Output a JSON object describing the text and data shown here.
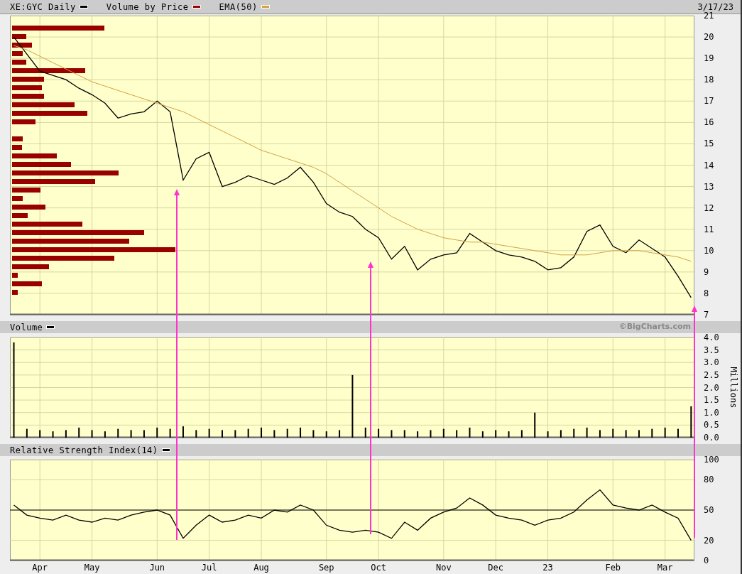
{
  "header": {
    "volume_by_price": {
      "label": "Volume by Price",
      "color": "#990000"
    },
    "date": "3/17/23"
  },
  "price_panel": {
    "chart_data": {
      "type": "line",
      "grid": true,
      "ylim": [
        7,
        21
      ],
      "categories": [
        null,
        null,
        null,
        null,
        null,
        null,
        null,
        null,
        null,
        null,
        null,
        null,
        null,
        null,
        null,
        null,
        null,
        null,
        null,
        null,
        null,
        null,
        null,
        null,
        null,
        null,
        null,
        null,
        null,
        null,
        null,
        null,
        null,
        null,
        null,
        null,
        null,
        null,
        null,
        null,
        null,
        null,
        null,
        null,
        null,
        null,
        null,
        null,
        null,
        null,
        null,
        null,
        null
      ],
      "yticks": [
        {
          "value": 7,
          "label": "7"
        },
        {
          "value": 8,
          "label": "8"
        },
        {
          "value": 9,
          "label": "9"
        },
        {
          "value": 10,
          "label": "10"
        },
        {
          "value": 11,
          "label": "11"
        },
        {
          "value": 12,
          "label": "12"
        },
        {
          "value": 13,
          "label": "13"
        },
        {
          "value": 14,
          "label": "14"
        },
        {
          "value": 15,
          "label": "15"
        },
        {
          "value": 16,
          "label": "16"
        },
        {
          "value": 17,
          "label": "17"
        },
        {
          "value": 18,
          "label": "18"
        },
        {
          "value": 19,
          "label": "19"
        },
        {
          "value": 20,
          "label": "20"
        },
        {
          "value": 21,
          "label": "21"
        }
      ],
      "series": [
        {
          "name": "XE:GYC Daily",
          "color": "#000000",
          "values": [
            20.0,
            19.2,
            18.4,
            18.2,
            18.0,
            17.6,
            17.3,
            16.9,
            16.2,
            16.4,
            16.5,
            17.0,
            16.5,
            13.3,
            14.3,
            14.6,
            13.0,
            13.2,
            13.5,
            13.3,
            13.1,
            13.4,
            13.9,
            13.2,
            12.2,
            11.8,
            11.6,
            11.0,
            10.6,
            9.6,
            10.2,
            9.1,
            9.6,
            9.8,
            9.9,
            10.8,
            10.4,
            10.0,
            9.8,
            9.7,
            9.5,
            9.1,
            9.2,
            9.7,
            10.9,
            11.2,
            10.2,
            9.9,
            10.5,
            10.1,
            9.7,
            8.8,
            7.8
          ]
        },
        {
          "name": "EMA(50)",
          "color": "#d4a040",
          "values": [
            19.6,
            19.4,
            19.1,
            18.8,
            18.5,
            18.2,
            17.9,
            17.7,
            17.5,
            17.3,
            17.1,
            16.9,
            16.7,
            16.5,
            16.2,
            15.9,
            15.6,
            15.3,
            15.0,
            14.7,
            14.5,
            14.3,
            14.1,
            13.9,
            13.6,
            13.2,
            12.8,
            12.4,
            12.0,
            11.6,
            11.3,
            11.0,
            10.8,
            10.6,
            10.5,
            10.4,
            10.4,
            10.3,
            10.2,
            10.1,
            10.0,
            9.9,
            9.8,
            9.8,
            9.8,
            9.9,
            10.0,
            10.0,
            10.0,
            9.9,
            9.8,
            9.7,
            9.5
          ]
        }
      ]
    }
  },
  "volume_panel": {
    "credit": "©BigCharts.com",
    "chart_data": {
      "type": "bar",
      "grid": true,
      "ylabel": "Millions",
      "ylim": [
        0,
        4
      ],
      "categories": [
        null,
        null,
        null,
        null,
        null,
        null,
        null,
        null,
        null,
        null,
        null,
        null,
        null,
        null,
        null,
        null,
        null,
        null,
        null,
        null,
        null,
        null,
        null,
        null,
        null,
        null,
        null,
        null,
        null,
        null,
        null,
        null,
        null,
        null,
        null,
        null,
        null,
        null,
        null,
        null,
        null,
        null,
        null,
        null,
        null,
        null,
        null,
        null,
        null,
        null,
        null,
        null,
        null
      ],
      "yticks": [
        {
          "value": 0,
          "label": "0.0"
        },
        {
          "value": 0.5,
          "label": "0.5"
        },
        {
          "value": 1,
          "label": "1.0"
        },
        {
          "value": 1.5,
          "label": "1.5"
        },
        {
          "value": 2,
          "label": "2.0"
        },
        {
          "value": 2.5,
          "label": "2.5"
        },
        {
          "value": 3,
          "label": "3.0"
        },
        {
          "value": 3.5,
          "label": "3.5"
        },
        {
          "value": 4,
          "label": "4.0"
        }
      ],
      "series": [
        {
          "name": "Volume",
          "color": "#000000",
          "values": [
            3.8,
            0.35,
            0.3,
            0.25,
            0.3,
            0.4,
            0.3,
            0.25,
            0.35,
            0.3,
            0.3,
            0.4,
            0.35,
            0.45,
            0.3,
            0.35,
            0.3,
            0.3,
            0.35,
            0.4,
            0.3,
            0.35,
            0.4,
            0.3,
            0.25,
            0.3,
            2.5,
            0.4,
            0.35,
            0.3,
            0.3,
            0.25,
            0.3,
            0.35,
            0.3,
            0.4,
            0.25,
            0.3,
            0.25,
            0.3,
            1.0,
            0.25,
            0.3,
            0.35,
            0.4,
            0.3,
            0.35,
            0.3,
            0.3,
            0.35,
            0.4,
            0.35,
            1.25
          ]
        }
      ]
    }
  },
  "rsi_panel": {
    "chart_data": {
      "type": "line",
      "grid": true,
      "ylim": [
        0,
        100
      ],
      "categories": [
        null,
        null,
        "Apr",
        null,
        null,
        null,
        "May",
        null,
        null,
        null,
        null,
        "Jun",
        null,
        null,
        null,
        "Jul",
        null,
        null,
        null,
        "Aug",
        null,
        null,
        null,
        null,
        "Sep",
        null,
        null,
        null,
        "Oct",
        null,
        null,
        null,
        null,
        "Nov",
        null,
        null,
        null,
        "Dec",
        null,
        null,
        null,
        "23",
        null,
        null,
        null,
        null,
        "Feb",
        null,
        null,
        null,
        "Mar",
        null,
        null
      ],
      "yticks": [
        {
          "value": 0,
          "label": "0"
        },
        {
          "value": 20,
          "label": "20"
        },
        {
          "value": 50,
          "label": "50"
        },
        {
          "value": 80,
          "label": "80"
        },
        {
          "value": 100,
          "label": "100"
        }
      ],
      "ref_lines": [
        {
          "axis": "y",
          "value": 50
        }
      ],
      "series": [
        {
          "name": "Relative Strength Index(14)",
          "color": "#000000",
          "values": [
            55,
            45,
            42,
            40,
            45,
            40,
            38,
            42,
            40,
            45,
            48,
            50,
            45,
            22,
            35,
            45,
            38,
            40,
            45,
            42,
            50,
            48,
            55,
            50,
            35,
            30,
            28,
            30,
            28,
            22,
            38,
            30,
            42,
            48,
            52,
            62,
            55,
            45,
            42,
            40,
            35,
            40,
            42,
            48,
            60,
            70,
            55,
            52,
            50,
            55,
            48,
            42,
            20
          ]
        }
      ]
    }
  }
}
